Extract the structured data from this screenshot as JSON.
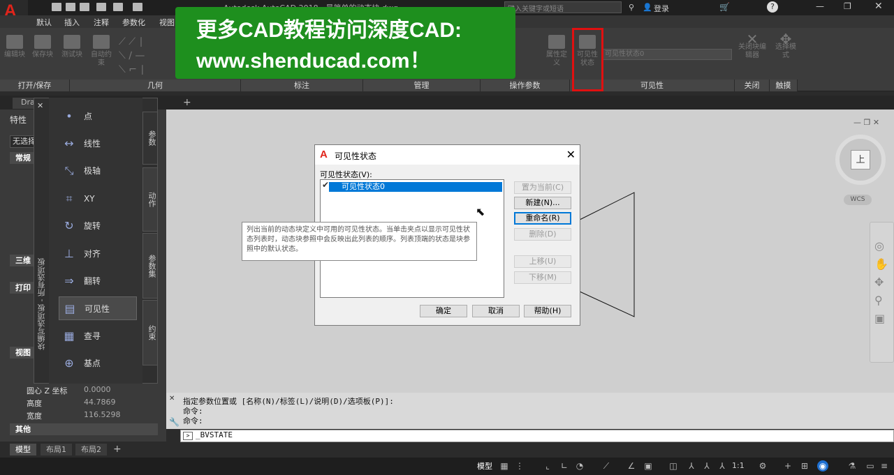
{
  "app": {
    "title_fragment": "Autodesk AutoCAD 2018 - 最简单的动态块.dwg",
    "search_placeholder": "键入关键字或短语",
    "login_label": "登录"
  },
  "ribbon_tabs": [
    "默认",
    "插入",
    "注释",
    "参数化",
    "视图"
  ],
  "ribbon_panels": [
    "打开/保存",
    "几何",
    "标注",
    "管理",
    "操作参数",
    "可见性",
    "关闭",
    "触摸"
  ],
  "ribbon_buttons": {
    "edit_block": "编辑块",
    "save_block": "保存块",
    "test_block": "测试块",
    "auto_constrain": "自动约束",
    "attribute_def": "属性定义",
    "visibility_state": "可见性状态",
    "close_editor": "关闭块编辑器",
    "select_mode": "选择模式",
    "visibility_dropdown": "可见性状态0"
  },
  "banner": {
    "line1": "更多CAD教程访问深度CAD:",
    "line2": "www.shenducad.com！"
  },
  "drawing_tab": "Dra",
  "properties": {
    "title": "特性",
    "no_selection": "无选择",
    "sections": {
      "general": "常规",
      "3d": "三维",
      "print": "打印",
      "view": "视图",
      "other": "其他"
    },
    "rows": [
      {
        "label": "圆心 Z 坐标",
        "value": "0.0000"
      },
      {
        "label": "高度",
        "value": "44.7869"
      },
      {
        "label": "宽度",
        "value": "116.5298"
      }
    ]
  },
  "palette": {
    "vertical_title": "块编写选项板 - 所有选项板",
    "tabs": [
      "参数",
      "动作",
      "参数集",
      "约束"
    ],
    "items": [
      "点",
      "线性",
      "极轴",
      "XY",
      "旋转",
      "对齐",
      "翻转",
      "可见性",
      "查寻",
      "基点"
    ]
  },
  "dialog": {
    "title": "可见性状态",
    "list_label": "可见性状态(V):",
    "selected_state": "可见性状态0",
    "buttons": {
      "set_current": "置为当前(C)",
      "new": "新建(N)...",
      "rename": "重命名(R)",
      "delete": "删除(D)",
      "move_up": "上移(U)",
      "move_down": "下移(M)",
      "ok": "确定",
      "cancel": "取消",
      "help": "帮助(H)"
    },
    "tooltip": "列出当前的动态块定义中可用的可见性状态。当单击夹点以显示可见性状态列表时，动态块参照中会反映出此列表的顺序。列表顶端的状态是块参照中的默认状态。"
  },
  "command": {
    "history": [
      "指定参数位置或 [名称(N)/标签(L)/说明(D)/选项板(P)]:",
      "命令:",
      "命令:"
    ],
    "input": "_BVSTATE"
  },
  "layout_tabs": [
    "模型",
    "布局1",
    "布局2"
  ],
  "status": {
    "model_label": "模型",
    "scale": "1:1"
  },
  "viewcube": {
    "face": "上",
    "wcs": "WCS"
  }
}
